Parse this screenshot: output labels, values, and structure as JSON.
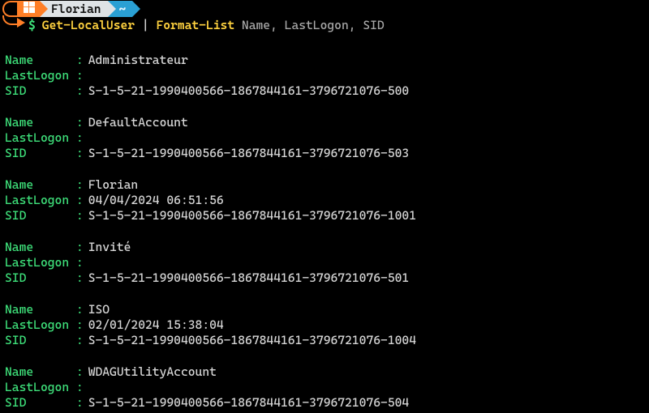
{
  "prompt": {
    "user": "Florian",
    "path": "~",
    "sigil": "$"
  },
  "command": {
    "cmd1": "Get-LocalUser",
    "pipe": " | ",
    "cmd2": "Format-List",
    "args": " Name, LastLogon, SID"
  },
  "labels": {
    "name": "Name",
    "lastlogon": "LastLogon",
    "sid": "SID"
  },
  "records": [
    {
      "Name": "Administrateur",
      "LastLogon": "",
      "SID": "S-1-5-21-1990400566-1867844161-3796721076-500"
    },
    {
      "Name": "DefaultAccount",
      "LastLogon": "",
      "SID": "S-1-5-21-1990400566-1867844161-3796721076-503"
    },
    {
      "Name": "Florian",
      "LastLogon": "04/04/2024 06:51:56",
      "SID": "S-1-5-21-1990400566-1867844161-3796721076-1001"
    },
    {
      "Name": "Invité",
      "LastLogon": "",
      "SID": "S-1-5-21-1990400566-1867844161-3796721076-501"
    },
    {
      "Name": "ISO",
      "LastLogon": "02/01/2024 15:38:04",
      "SID": "S-1-5-21-1990400566-1867844161-3796721076-1004"
    },
    {
      "Name": "WDAGUtilityAccount",
      "LastLogon": "",
      "SID": "S-1-5-21-1990400566-1867844161-3796721076-504"
    }
  ]
}
